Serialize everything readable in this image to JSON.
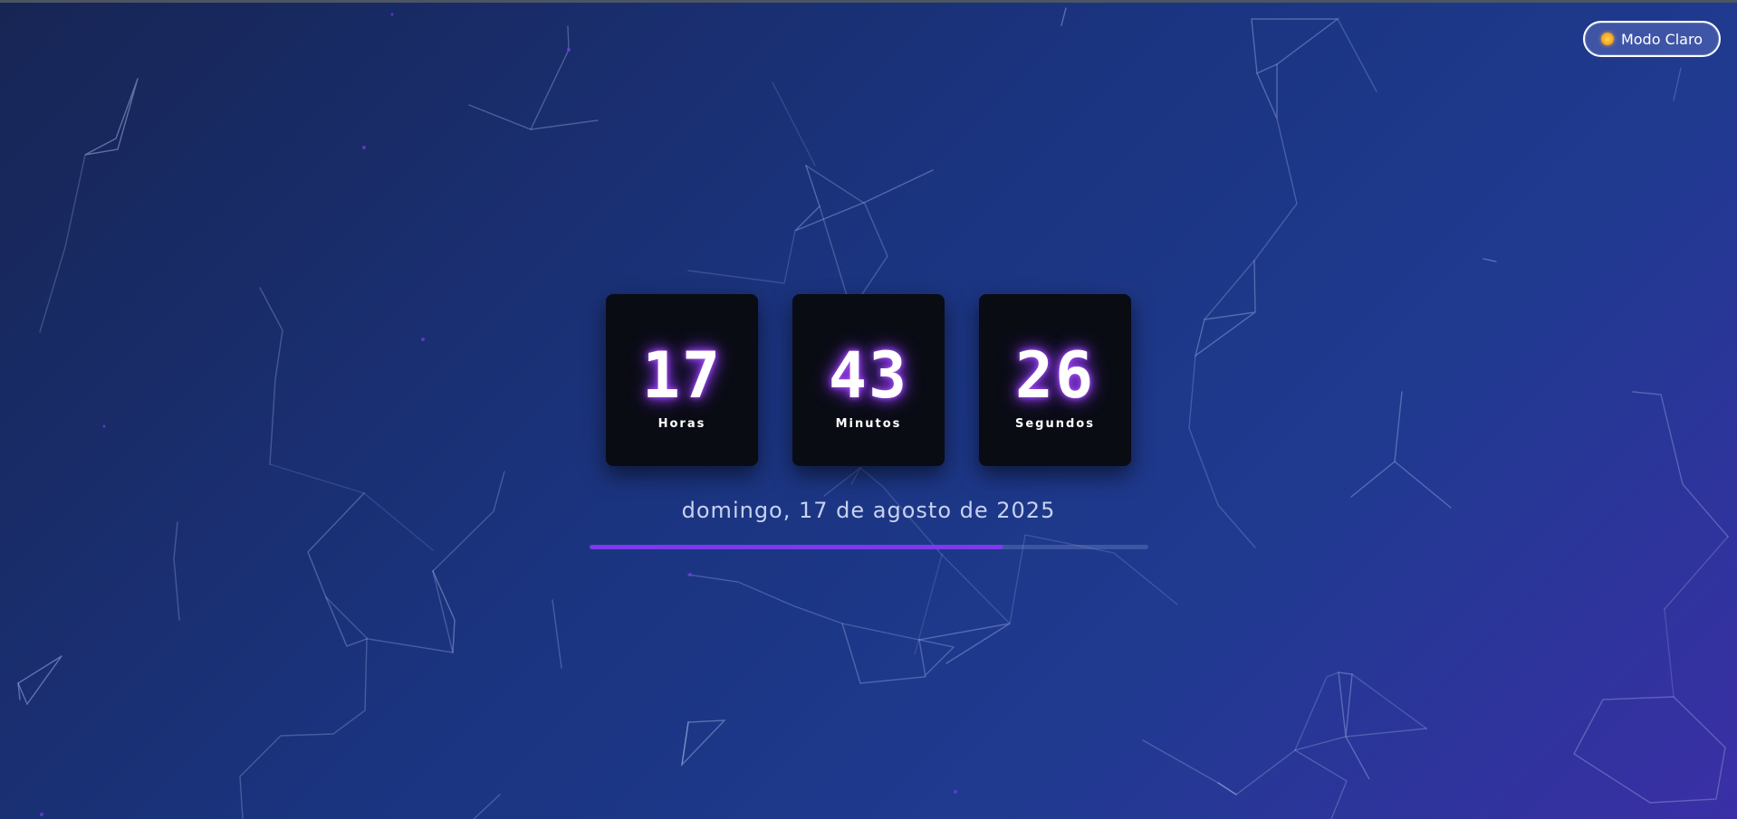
{
  "theme_toggle": {
    "icon": "sun-icon",
    "label": "Modo Claro"
  },
  "clock": {
    "hours": {
      "value": "17",
      "label": "Horas"
    },
    "minutes": {
      "value": "43",
      "label": "Minutos"
    },
    "seconds": {
      "value": "26",
      "label": "Segundos"
    }
  },
  "date": {
    "text": "domingo, 17 de agosto de 2025"
  },
  "day_progress": {
    "fraction": 0.74,
    "color": "#7c3aed"
  },
  "colors": {
    "accent": "#7c3aed",
    "card_bg": "#0a0c14",
    "digit_glow": "#a855f7"
  }
}
